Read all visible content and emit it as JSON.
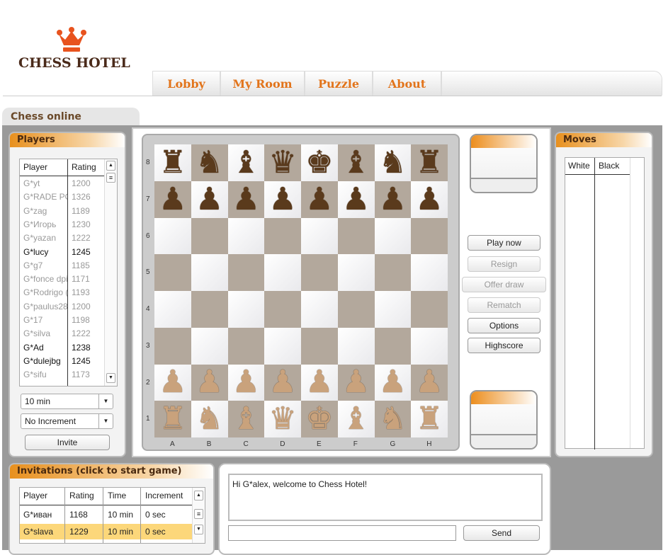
{
  "logo": {
    "text": "CHESS HOTEL",
    "crown_color": "#e8531e"
  },
  "nav": [
    {
      "label": "Lobby"
    },
    {
      "label": "My Room"
    },
    {
      "label": "Puzzle"
    },
    {
      "label": "About"
    }
  ],
  "section_tab": "Chess online",
  "players": {
    "title": "Players",
    "columns": [
      "Player",
      "Rating"
    ],
    "rows": [
      {
        "name": "G*yt",
        "rating": "1200",
        "active": false
      },
      {
        "name": "G*RADE PC",
        "rating": "1326",
        "active": false
      },
      {
        "name": "G*zag",
        "rating": "1189",
        "active": false
      },
      {
        "name": "G*Игорь",
        "rating": "1230",
        "active": false
      },
      {
        "name": "G*yazan",
        "rating": "1222",
        "active": false
      },
      {
        "name": "G*lucy",
        "rating": "1245",
        "active": true
      },
      {
        "name": "G*g7",
        "rating": "1185",
        "active": false
      },
      {
        "name": "G*fonce dpi",
        "rating": "1171",
        "active": false
      },
      {
        "name": "G*Rodrigo (",
        "rating": "1193",
        "active": false
      },
      {
        "name": "G*paulus28",
        "rating": "1200",
        "active": false
      },
      {
        "name": "G*17",
        "rating": "1198",
        "active": false
      },
      {
        "name": "G*silva",
        "rating": "1222",
        "active": false
      },
      {
        "name": "G*Ad",
        "rating": "1238",
        "active": true
      },
      {
        "name": "G*dulejbg",
        "rating": "1245",
        "active": true
      },
      {
        "name": "G*sifu",
        "rating": "1173",
        "active": false
      }
    ],
    "time_select": "10 min",
    "increment_select": "No Increment",
    "invite_label": "Invite"
  },
  "board": {
    "files": [
      "A",
      "B",
      "C",
      "D",
      "E",
      "F",
      "G",
      "H"
    ],
    "ranks": [
      "8",
      "7",
      "6",
      "5",
      "4",
      "3",
      "2",
      "1"
    ],
    "layout": [
      "rnbqkbnr",
      "pppppppp",
      "........",
      "........",
      "........",
      "........",
      "PPPPPPPP",
      "RNBQKBNR"
    ],
    "light_color": "#ffffff",
    "dark_color": "#b3a89c",
    "black_piece_color": "#5a3a1c",
    "white_piece_color": "#c9a27c"
  },
  "controls": {
    "buttons": [
      {
        "label": "Play now",
        "enabled": true
      },
      {
        "label": "Resign",
        "enabled": false
      },
      {
        "label": "Offer draw",
        "enabled": false
      },
      {
        "label": "Rematch",
        "enabled": false
      },
      {
        "label": "Options",
        "enabled": true
      },
      {
        "label": "Highscore",
        "enabled": true
      }
    ]
  },
  "moves": {
    "title": "Moves",
    "columns": [
      "White",
      "Black"
    ]
  },
  "invitations": {
    "title": "Invitations (click to start game)",
    "columns": [
      "Player",
      "Rating",
      "Time",
      "Increment"
    ],
    "rows": [
      {
        "player": "G*иван",
        "rating": "1168",
        "time": "10 min",
        "increment": "0 sec",
        "selected": false
      },
      {
        "player": "G*slava",
        "rating": "1229",
        "time": "10 min",
        "increment": "0 sec",
        "selected": true
      }
    ],
    "highlight_color": "#fcd77a"
  },
  "chat": {
    "messages": [
      "Hi G*alex, welcome to Chess Hotel!"
    ],
    "input_value": "",
    "send_label": "Send"
  }
}
